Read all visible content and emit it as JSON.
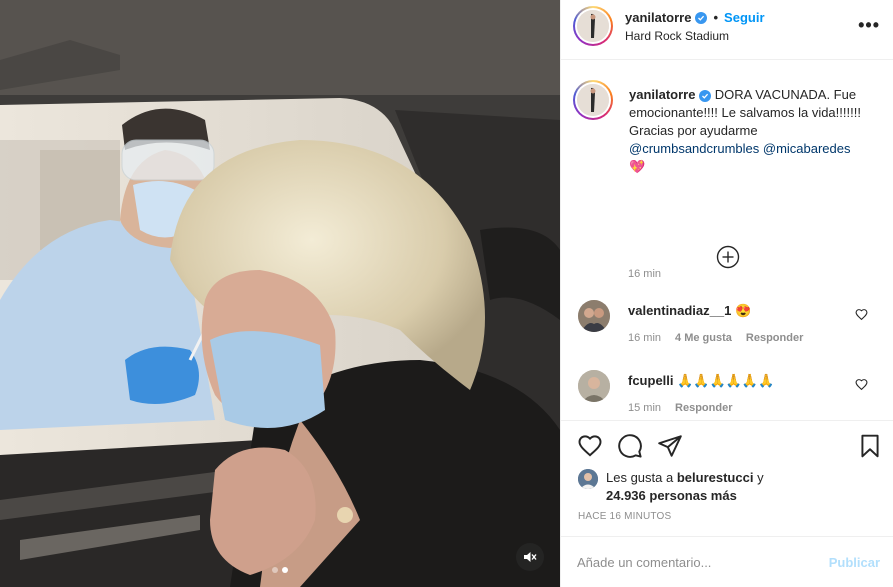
{
  "header": {
    "username": "yanilatorre",
    "separator": "•",
    "follow_label": "Seguir",
    "location": "Hard Rock Stadium",
    "more_label": "•••"
  },
  "caption": {
    "username": "yanilatorre",
    "text_line1": "DORA VACUNADA. Fue emocionante!!!! Le salvamos la vida!!!!!!!",
    "text_line2": "Gracias por ayudarme",
    "mention1": "@crumbsandcrumbles",
    "mention2": "@micabaredes",
    "emoji": "💖",
    "time": "16 min"
  },
  "comments": [
    {
      "username": "valentinadiaz__1",
      "text": "😍",
      "time": "16 min",
      "likes": "4 Me gusta",
      "reply": "Responder"
    },
    {
      "username": "fcupelli",
      "text": "🙏🙏🙏🙏🙏🙏",
      "time": "15 min",
      "likes": "",
      "reply": "Responder"
    }
  ],
  "likes": {
    "prefix": "Les gusta a",
    "user": "belurestucci",
    "suffix": "y",
    "others": "24.936 personas más"
  },
  "posted_ago": "HACE 16 MINUTOS",
  "composer": {
    "placeholder": "Añade un comentario...",
    "publish_label": "Publicar"
  },
  "media": {
    "slide_count": 2,
    "active_slide": 2
  },
  "colors": {
    "accent": "#0095f6",
    "publish_disabled": "#b2dffc",
    "mention": "#00376b",
    "muted_text": "#8e8e8e",
    "verified": "#3897f0"
  }
}
